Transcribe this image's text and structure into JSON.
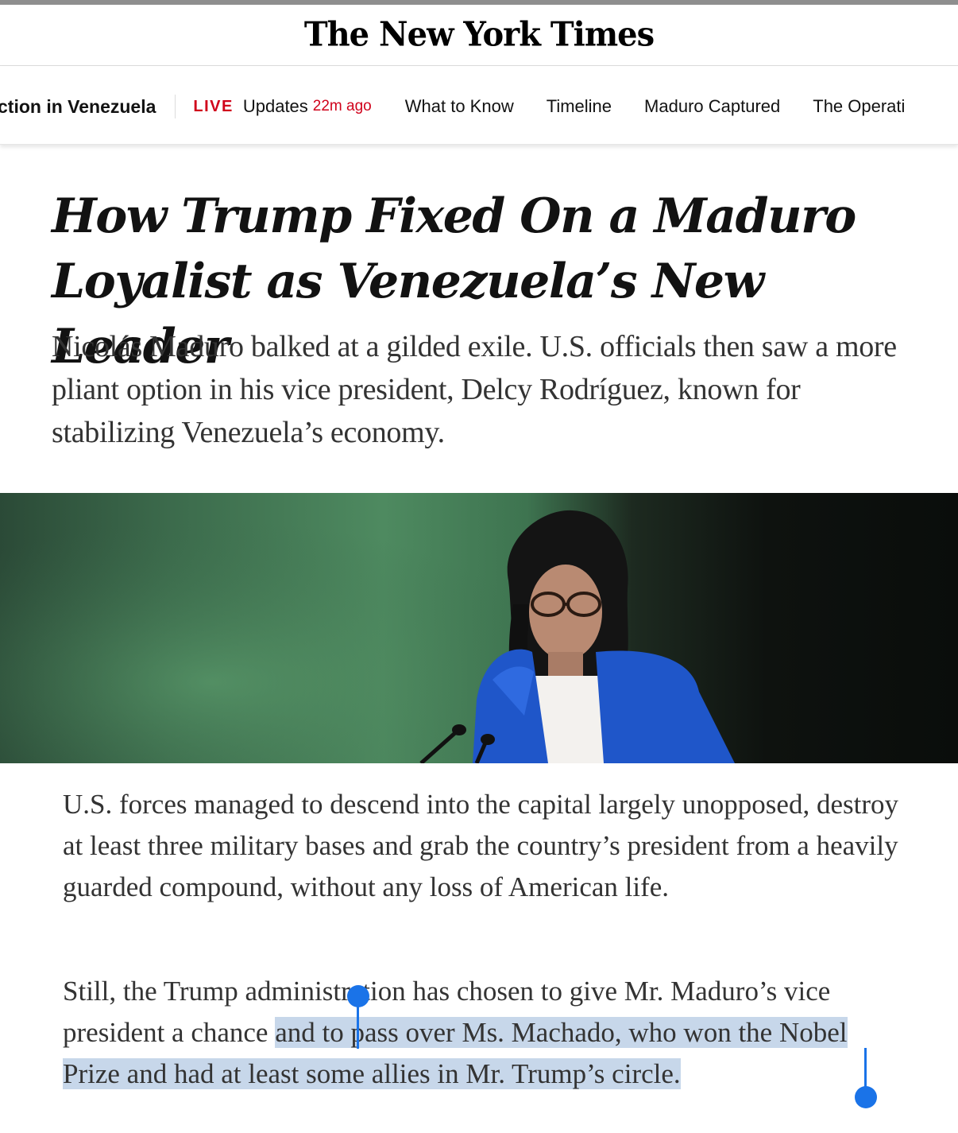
{
  "masthead": {
    "logo": "The New York Times"
  },
  "subnav": {
    "section": "ction in Venezuela",
    "live_badge": "LIVE",
    "live_text": "Updates",
    "live_time": "22m ago",
    "links": [
      "What to Know",
      "Timeline",
      "Maduro Captured",
      "The Operati"
    ]
  },
  "article": {
    "headline": "How Trump Fixed On a Maduro Loyalist as Venezuela’s New Leader",
    "dek": "Nicolás Maduro balked at a gilded exile. U.S. officials then saw a more pliant option in his vice president, Delcy Rodríguez, known for stabilizing Venezuela’s economy.",
    "paragraph1": "U.S. forces managed to descend into the capital largely unopposed, destroy at least three military bases and grab the country’s president from a heavily guarded compound, without any loss of American life.",
    "paragraph2_before": "Still, the Trump administration has chosen to give Mr. Maduro’s vice president a chance ",
    "paragraph2_selected": "and to pass over Ms. Machado, who won the Nobel Prize and had at least some allies in Mr. Trump’s circle."
  },
  "colors": {
    "live_red": "#d0021b",
    "selection": "#c7d7ea",
    "handle_blue": "#1a73e8"
  }
}
